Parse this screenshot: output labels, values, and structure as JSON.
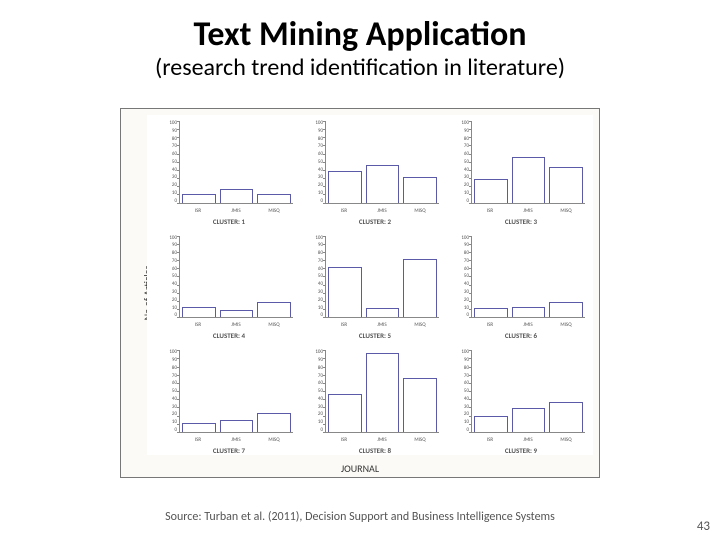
{
  "title": "Text Mining Application",
  "subtitle": "(research trend identification in literature)",
  "source": "Source: Turban et al. (2011), Decision Support and Business Intelligence Systems",
  "page_number": "43",
  "y_axis_label": "No of Articles",
  "x_axis_label": "JOURNAL",
  "chart_data": {
    "type": "bar",
    "ylim": [
      0,
      100
    ],
    "yticks": [
      100,
      90,
      80,
      70,
      60,
      50,
      40,
      30,
      20,
      10,
      0
    ],
    "panels": [
      {
        "title": "CLUSTER: 1",
        "categories": [
          "ISR",
          "JMIS",
          "MISQ"
        ],
        "values": [
          10,
          16,
          10
        ]
      },
      {
        "title": "CLUSTER: 2",
        "categories": [
          "ISR",
          "JMIS",
          "MISQ"
        ],
        "values": [
          38,
          45,
          30
        ]
      },
      {
        "title": "CLUSTER: 3",
        "categories": [
          "ISR",
          "JMIS",
          "MISQ"
        ],
        "values": [
          28,
          55,
          42
        ]
      },
      {
        "title": "CLUSTER: 4",
        "categories": [
          "ISR",
          "JMIS",
          "MISQ"
        ],
        "values": [
          12,
          8,
          18
        ]
      },
      {
        "title": "CLUSTER: 5",
        "categories": [
          "ISR",
          "JMIS",
          "MISQ"
        ],
        "values": [
          60,
          10,
          70
        ]
      },
      {
        "title": "CLUSTER: 6",
        "categories": [
          "ISR",
          "JMIS",
          "MISQ"
        ],
        "values": [
          10,
          12,
          18
        ]
      },
      {
        "title": "CLUSTER: 7",
        "categories": [
          "ISR",
          "JMIS",
          "MISQ"
        ],
        "values": [
          10,
          14,
          22
        ]
      },
      {
        "title": "CLUSTER: 8",
        "categories": [
          "ISR",
          "JMIS",
          "MISQ"
        ],
        "values": [
          45,
          95,
          65
        ]
      },
      {
        "title": "CLUSTER: 9",
        "categories": [
          "ISR",
          "JMIS",
          "MISQ"
        ],
        "values": [
          18,
          28,
          35
        ]
      }
    ]
  }
}
